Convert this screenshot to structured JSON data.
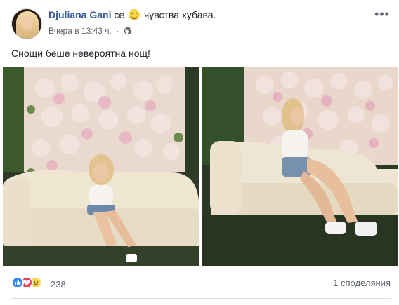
{
  "post": {
    "author": "Djuliana Gani",
    "feeling_prefix": "се",
    "feeling_text": "чувства хубава.",
    "timestamp": "Вчера в 13:43 ч.",
    "separator": "·",
    "privacy_icon": "globe-icon",
    "text": "Снощи беше невероятна нощ!",
    "photos": [
      {
        "name": "photo-left",
        "description_icon": "image"
      },
      {
        "name": "photo-right",
        "description_icon": "image"
      }
    ]
  },
  "footer": {
    "reactions": [
      "like-icon",
      "love-icon",
      "sad-icon"
    ],
    "reaction_count": "238",
    "shares": "1 споделяния"
  },
  "colors": {
    "author_link": "#385898",
    "secondary_text": "#616770",
    "like": "#2d88ff",
    "love": "#f33e58",
    "sad": "#f7d44c"
  }
}
